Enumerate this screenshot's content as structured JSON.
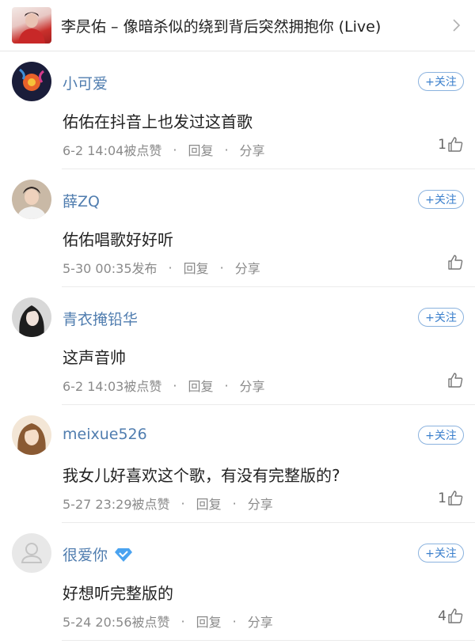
{
  "header": {
    "song_title": "李昃佑 – 像暗杀似的绕到背后突然拥抱你 (Live)"
  },
  "follow_label": "+关注",
  "reply_label": "回复",
  "share_label": "分享",
  "separator": "·",
  "comments": [
    {
      "username": "小可爱",
      "text": "佑佑在抖音上也发过这首歌",
      "time": "6-2 14:04被点赞",
      "likes": "1",
      "avatar_icon": "flower-avatar"
    },
    {
      "username": "薛ZQ",
      "text": "佑佑唱歌好好听",
      "time": "5-30 00:35发布",
      "likes": "",
      "avatar_icon": "man-avatar"
    },
    {
      "username": "青衣掩铅华",
      "text": "这声音帅",
      "time": "6-2 14:03被点赞",
      "likes": "",
      "avatar_icon": "woman-avatar"
    },
    {
      "username": "meixue526",
      "text": "我女儿好喜欢这个歌，有没有完整版的?",
      "time": "5-27 23:29被点赞",
      "likes": "1",
      "avatar_icon": "girl-avatar"
    },
    {
      "username": "很爱你",
      "text": "好想听完整版的",
      "time": "5-24 20:56被点赞",
      "likes": "4",
      "avatar_icon": "default-avatar",
      "badge_icon": "diamond-vip-icon"
    }
  ],
  "colors": {
    "username": "#507daf",
    "follow_border": "#8ab2de",
    "meta": "#8a8a8a",
    "vip_badge": "#4aa3f0"
  }
}
